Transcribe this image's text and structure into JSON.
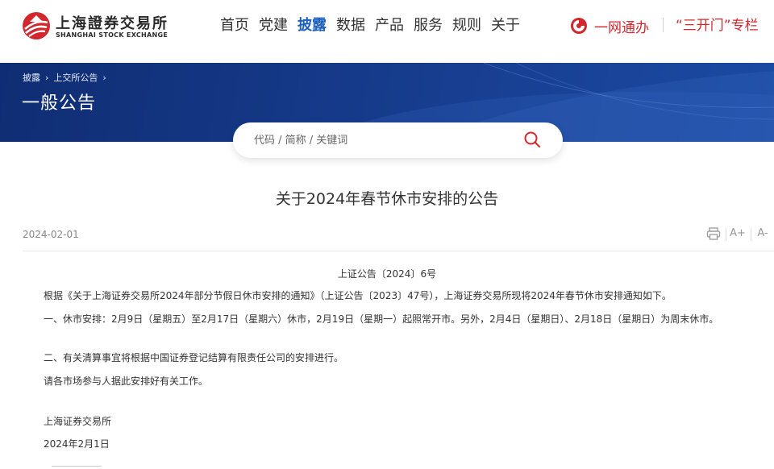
{
  "header": {
    "logo_cn": "上海證券交易所",
    "logo_en": "SHANGHAI STOCK EXCHANGE",
    "nav": [
      "首页",
      "党建",
      "披露",
      "数据",
      "产品",
      "服务",
      "规则",
      "关于"
    ],
    "active_nav": "披露",
    "ywtb": "一网通办",
    "skm": "“三开门”专栏"
  },
  "banner": {
    "breadcrumb": [
      "披露",
      "上交所公告"
    ],
    "title": "一般公告"
  },
  "search": {
    "placeholder": "代码 / 简称 / 关键词"
  },
  "article": {
    "title": "关于2024年春节休市安排的公告",
    "date": "2024-02-01",
    "tools": {
      "print": "print-icon",
      "font_up": "A+",
      "font_down": "A-"
    },
    "doc_no": "上证公告〔2024〕6号",
    "paragraphs": [
      "根据《关于上海证券交易所2024年部分节假日休市安排的通知》（上证公告〔2023〕47号），上海证券交易所现将2024年春节休市安排通知如下。",
      "一、休市安排：2月9日（星期五）至2月17日（星期六）休市，2月19日（星期一）起照常开市。另外，2月4日（星期日）、2月18日（星期日）为周末休市。",
      "二、有关清算事宜将根据中国证券登记结算有限责任公司的安排进行。",
      "请各市场参与人据此安排好有关工作。"
    ],
    "signature": "上海证券交易所",
    "sign_date": "2024年2月1日"
  },
  "colors": {
    "brand_red": "#d3272e",
    "nav_active": "#1a5fbf",
    "banner_blue": "#163a8a"
  }
}
